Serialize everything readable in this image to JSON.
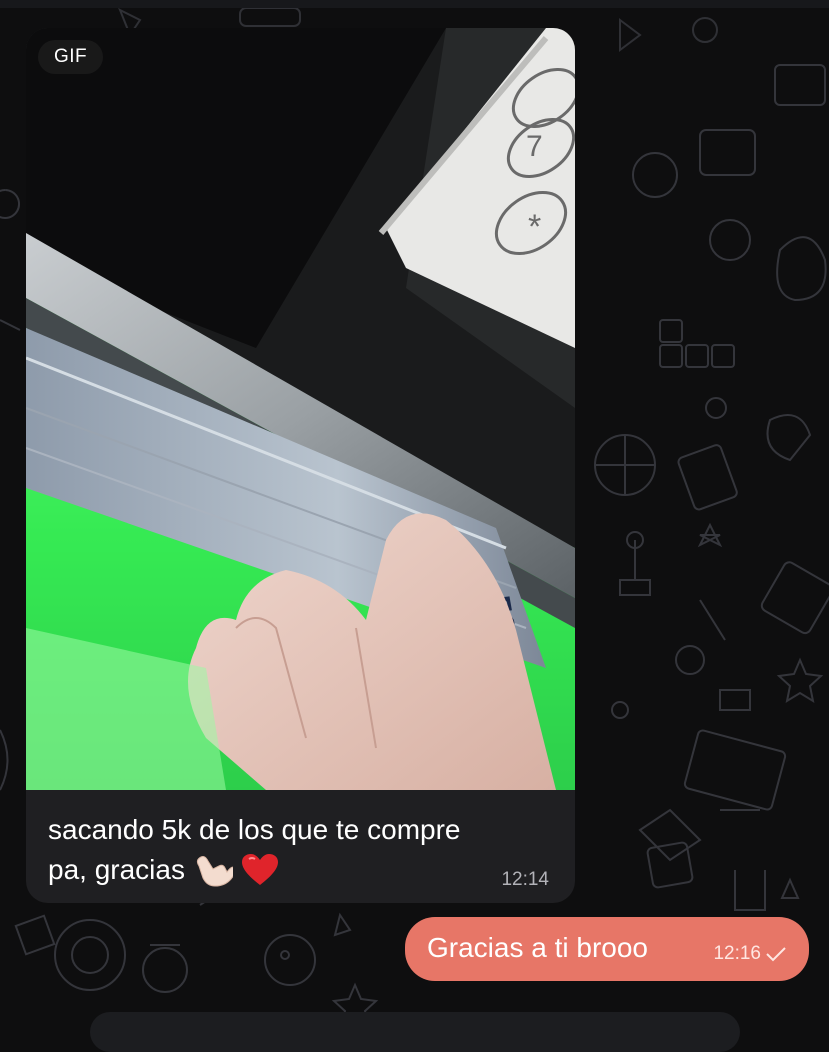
{
  "chat": {
    "messages": [
      {
        "direction": "incoming",
        "media_badge": "GIF",
        "text_line1": "sacando 5k de los que te compre",
        "text_line2": "pa, gracias",
        "emojis": [
          "call-me-hand-emoji",
          "red-heart-emoji"
        ],
        "time": "12:14"
      },
      {
        "direction": "outgoing",
        "text": "Gracias a ti brooo",
        "time": "12:16",
        "status_icon": "single-check-icon"
      }
    ]
  },
  "colors": {
    "background": "#0e0e0f",
    "incoming_bubble": "#1f1f22",
    "outgoing_bubble": "#e77667",
    "wallpaper_doodle": "#3a3b41"
  }
}
